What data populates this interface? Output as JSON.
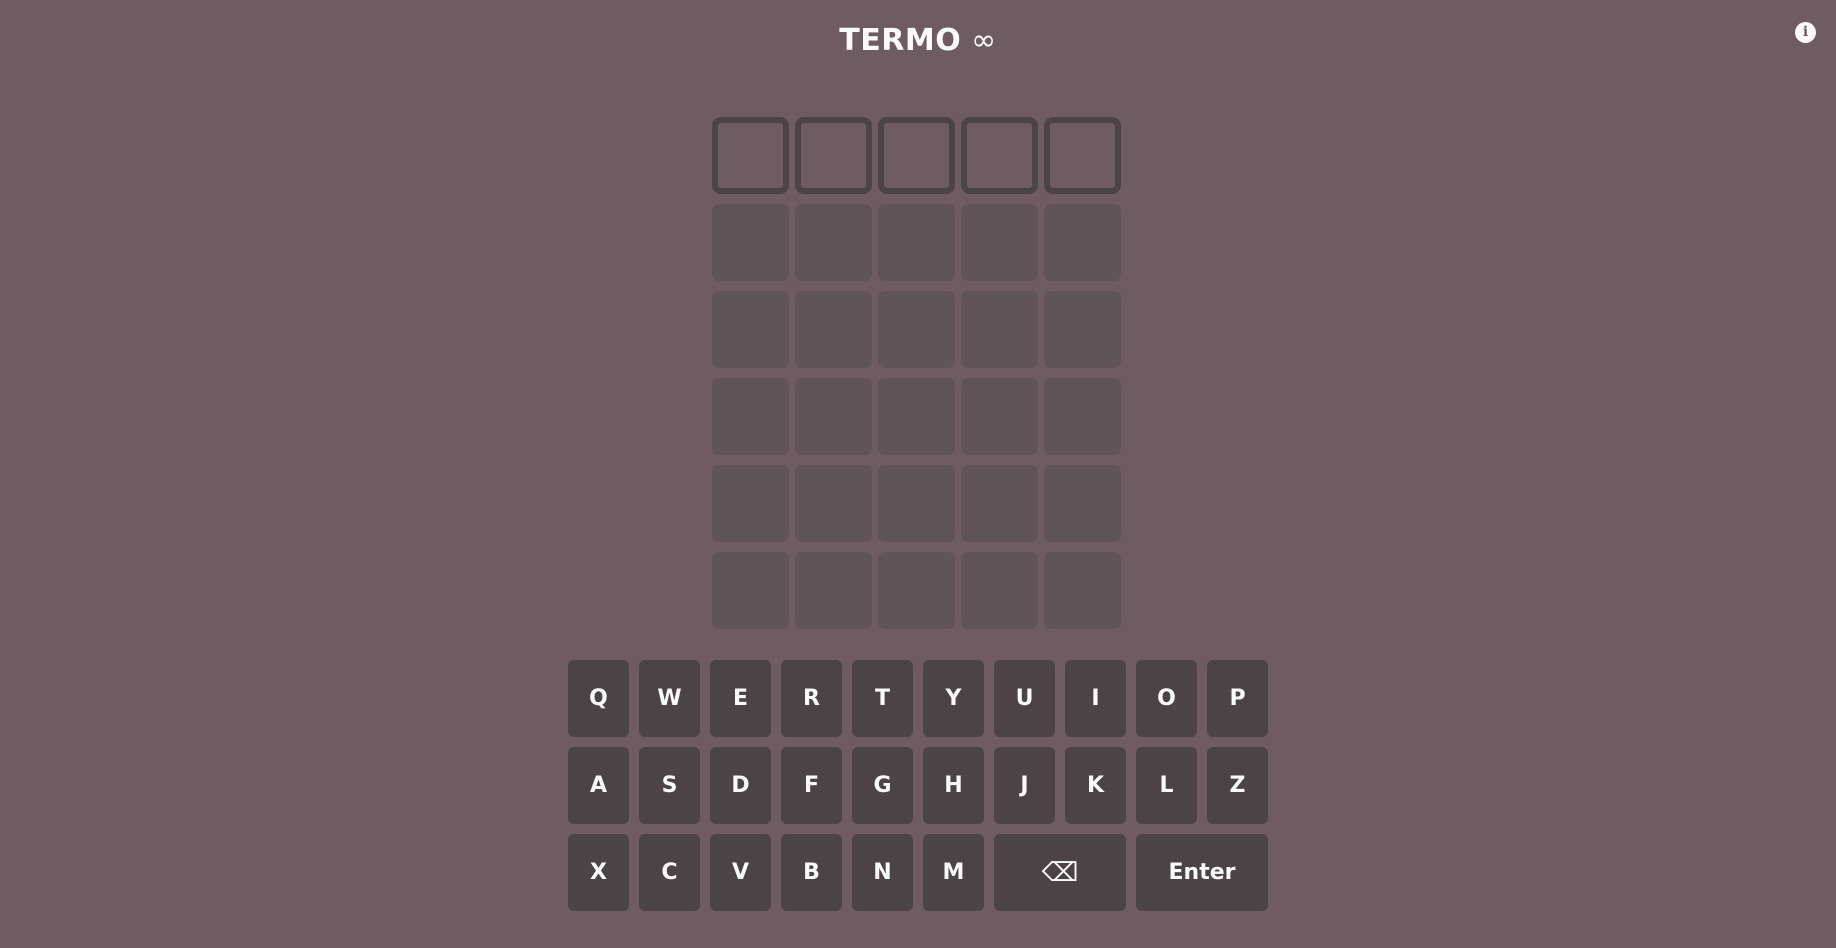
{
  "header": {
    "title": "TERMO",
    "infinity": "∞",
    "info_icon": "i"
  },
  "board": {
    "rows": 6,
    "cols": 5,
    "active_row": 0,
    "letters": [
      [
        "",
        "",
        "",
        "",
        ""
      ],
      [
        "",
        "",
        "",
        "",
        ""
      ],
      [
        "",
        "",
        "",
        "",
        ""
      ],
      [
        "",
        "",
        "",
        "",
        ""
      ],
      [
        "",
        "",
        "",
        "",
        ""
      ],
      [
        "",
        "",
        "",
        "",
        ""
      ]
    ]
  },
  "keyboard": {
    "row1": [
      "Q",
      "W",
      "E",
      "R",
      "T",
      "Y",
      "U",
      "I",
      "O",
      "P"
    ],
    "row2": [
      "A",
      "S",
      "D",
      "F",
      "G",
      "H",
      "J",
      "K",
      "L",
      "Z"
    ],
    "row3": [
      "X",
      "C",
      "V",
      "B",
      "N",
      "M"
    ],
    "backspace_label": "⌫",
    "enter_label": "Enter"
  },
  "colors": {
    "background": "#6e5c62",
    "tile_empty": "#615458",
    "tile_active_border": "#4c4347",
    "key": "#4c4347",
    "text": "#fafafa"
  }
}
